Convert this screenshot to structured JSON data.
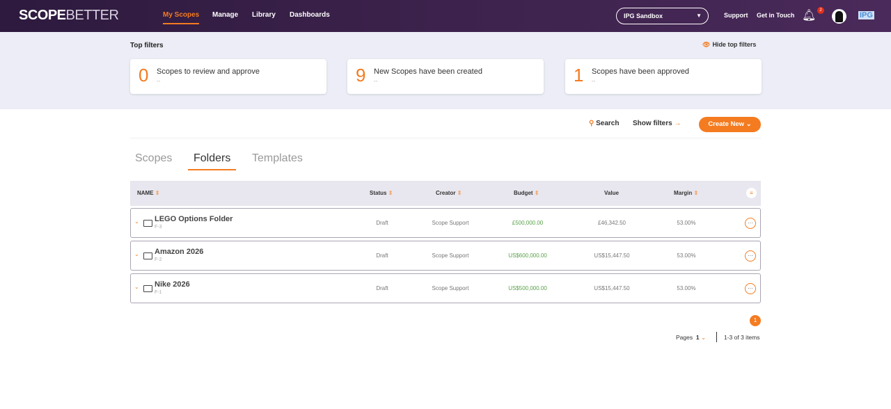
{
  "nav": {
    "logo_a": "SCOPE",
    "logo_b": "BETTER",
    "links": [
      "My Scopes",
      "Manage",
      "Library",
      "Dashboards"
    ],
    "workspace": "IPG Sandbox",
    "support": "Support",
    "contact": "Get in Touch",
    "notifications": "2",
    "org": "IPG"
  },
  "filters": {
    "title": "Top filters",
    "hide": "Hide top filters",
    "cards": [
      {
        "num": "0",
        "label": "Scopes to review and approve",
        "sub": "--"
      },
      {
        "num": "9",
        "label": "New Scopes have been created",
        "sub": "--"
      },
      {
        "num": "1",
        "label": "Scopes have been approved",
        "sub": "--"
      }
    ]
  },
  "toolbar": {
    "search": "Search",
    "show_filters": "Show filters",
    "create": "Create New"
  },
  "tabs": [
    "Scopes",
    "Folders",
    "Templates"
  ],
  "table": {
    "headers": [
      "NAME",
      "Status",
      "Creator",
      "Budget",
      "Value",
      "Margin"
    ],
    "rows": [
      {
        "name": "LEGO Options Folder",
        "code": "F-3",
        "status": "Draft",
        "creator": "Scope Support",
        "budget": "£500,000.00",
        "value": "£46,342.50",
        "margin": "53.00%"
      },
      {
        "name": "Amazon 2026",
        "code": "F-2",
        "status": "Draft",
        "creator": "Scope Support",
        "budget": "US$600,000.00",
        "value": "US$15,447.50",
        "margin": "53.00%"
      },
      {
        "name": "Nike 2026",
        "code": "F-1",
        "status": "Draft",
        "creator": "Scope Support",
        "budget": "US$500,000.00",
        "value": "US$15,447.50",
        "margin": "53.00%"
      }
    ]
  },
  "pagination": {
    "current": "1",
    "pages_label": "Pages",
    "page_value": "1",
    "items": "1-3 of 3 items"
  }
}
